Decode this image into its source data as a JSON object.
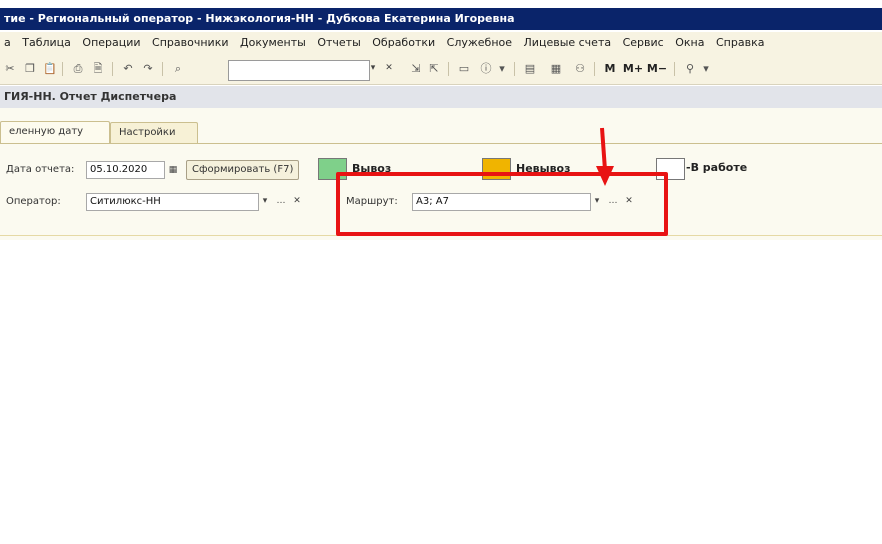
{
  "window": {
    "title": "тие - Региональный оператор - Нижэкология-НН - Дубкова Екатерина Игоревна"
  },
  "menu": {
    "items": [
      "а",
      "Таблица",
      "Операции",
      "Справочники",
      "Документы",
      "Отчеты",
      "Обработки",
      "Служебное",
      "Лицевые счета",
      "Сервис",
      "Окна",
      "Справка"
    ]
  },
  "toolbar": {
    "search_value": "",
    "m_label": "M",
    "m_plus_label": "M+",
    "m_minus_label": "M−"
  },
  "document": {
    "title": "ГИЯ-НН. Отчет Диспетчера"
  },
  "tabs": [
    "еленную дату",
    "Настройки"
  ],
  "form": {
    "report_date_label": "Дата отчета:",
    "report_date_value": "05.10.2020",
    "generate_button": "Сформировать (F7)",
    "operator_label": "Оператор:",
    "operator_value": "Ситилюкс-НН",
    "route_label": "Маршрут:",
    "route_value": "А3; А7"
  },
  "legend": [
    {
      "label": "Вывоз",
      "color": "#7fd08a"
    },
    {
      "label": "Невывоз",
      "color": "#f0b400"
    },
    {
      "label": "-В работе",
      "color": "#ffffff"
    }
  ],
  "colors": {
    "highlight": "#e81313"
  }
}
